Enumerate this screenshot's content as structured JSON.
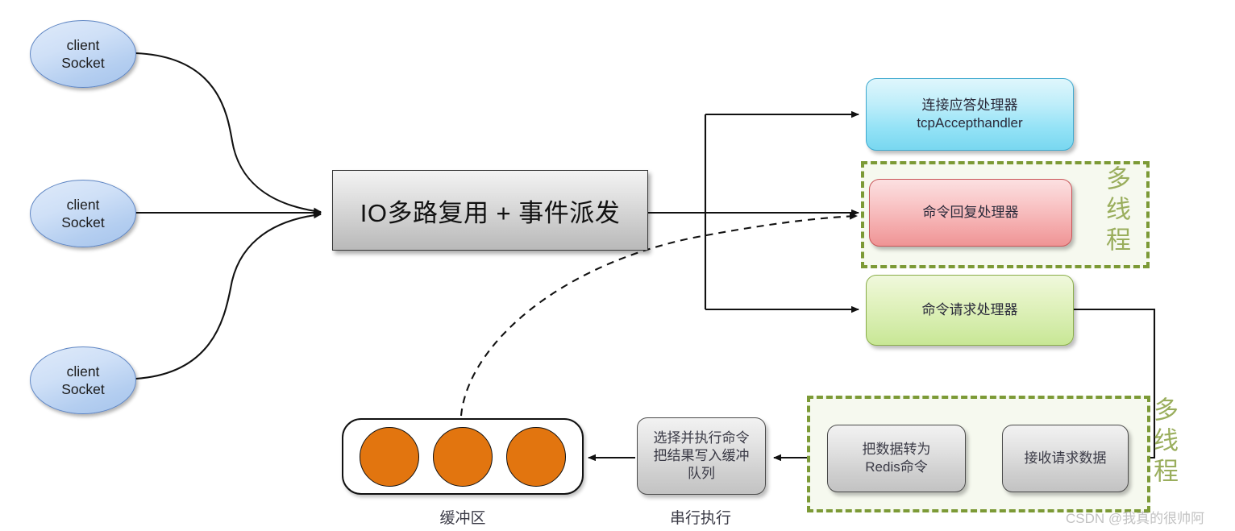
{
  "diagram": {
    "title": "Redis IO multiplexing and event dispatch architecture",
    "watermark": "CSDN @我真的很帅阿",
    "colors": {
      "client_socket": "#b4cef0",
      "io_box": "#c9c9c9",
      "accept_handler": "#93e2f6",
      "reply_handler": "#f4aaab",
      "request_handler": "#d4ecaa",
      "gray_step": "#cfcfcf",
      "buffer_item": "#e2750f",
      "multithread_group": "#7c9a36"
    }
  },
  "clients": [
    {
      "line1": "client",
      "line2": "Socket"
    },
    {
      "line1": "client",
      "line2": "Socket"
    },
    {
      "line1": "client",
      "line2": "Socket"
    }
  ],
  "core": {
    "io_box_label": "IO多路复用 + 事件派发"
  },
  "handlers": {
    "accept": {
      "line1": "连接应答处理器",
      "line2": "tcpAccepthandler"
    },
    "reply": {
      "line1": "命令回复处理器"
    },
    "request": {
      "line1": "命令请求处理器"
    }
  },
  "groups": {
    "multithread_top": "多线程",
    "multithread_bottom": "多线程"
  },
  "pipeline": {
    "receive": {
      "line1": "接收请求数据"
    },
    "convert": {
      "line1": "把数据转为",
      "line2": "Redis命令"
    },
    "execute": {
      "line1": "选择并执行命令",
      "line2": "把结果写入缓冲",
      "line3": "队列"
    }
  },
  "buffer": {
    "items": [
      "",
      "",
      ""
    ],
    "caption": "缓冲区"
  },
  "captions": {
    "serial_execution": "串行执行"
  }
}
